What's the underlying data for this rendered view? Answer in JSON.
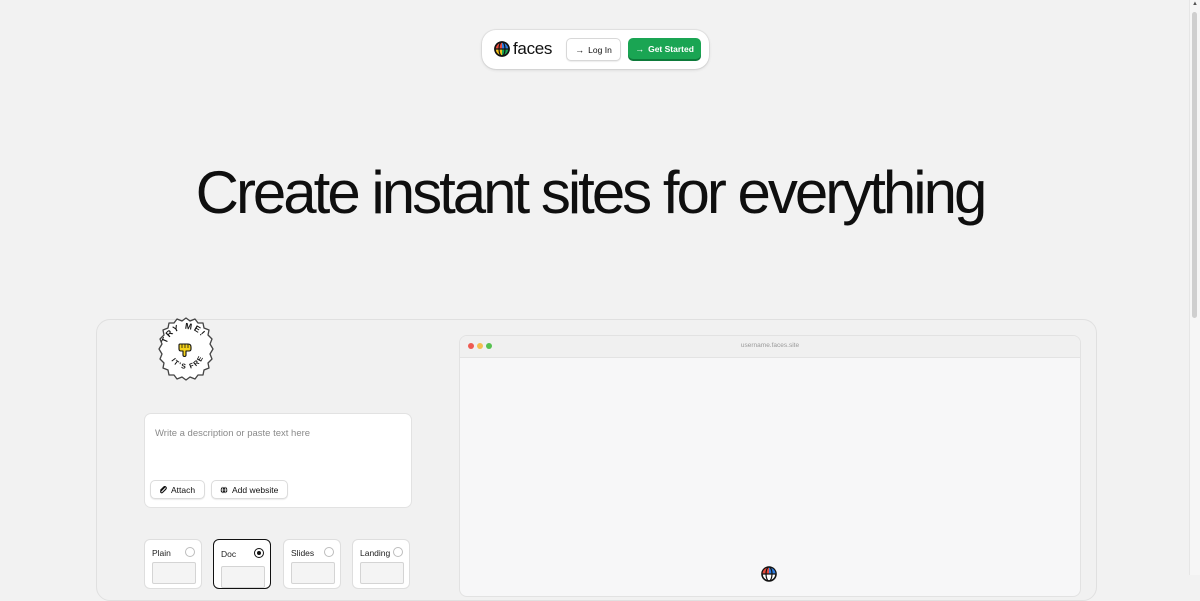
{
  "nav": {
    "brand": "faces",
    "login_label": "Log In",
    "start_label": "Get Started",
    "arrow_glyph": "→"
  },
  "hero": {
    "headline": "Create instant sites for everything"
  },
  "badge": {
    "top_text": "TRY ME!",
    "bottom_text": "IT'S FREE",
    "icon": "pointing-hand-icon"
  },
  "prompt": {
    "placeholder": "Write a description or paste text here",
    "value": "",
    "attach_label": "Attach",
    "add_website_label": "Add website"
  },
  "templates": [
    {
      "label": "Plain",
      "selected": false
    },
    {
      "label": "Doc",
      "selected": true
    },
    {
      "label": "Slides",
      "selected": false
    },
    {
      "label": "Landing",
      "selected": false
    }
  ],
  "preview": {
    "url": "username.faces.site"
  },
  "colors": {
    "accent": "#1aa553",
    "background": "#f2f2f2",
    "dot_red": "#ee5a52",
    "dot_yellow": "#f4bf4f",
    "dot_green": "#56c150"
  }
}
